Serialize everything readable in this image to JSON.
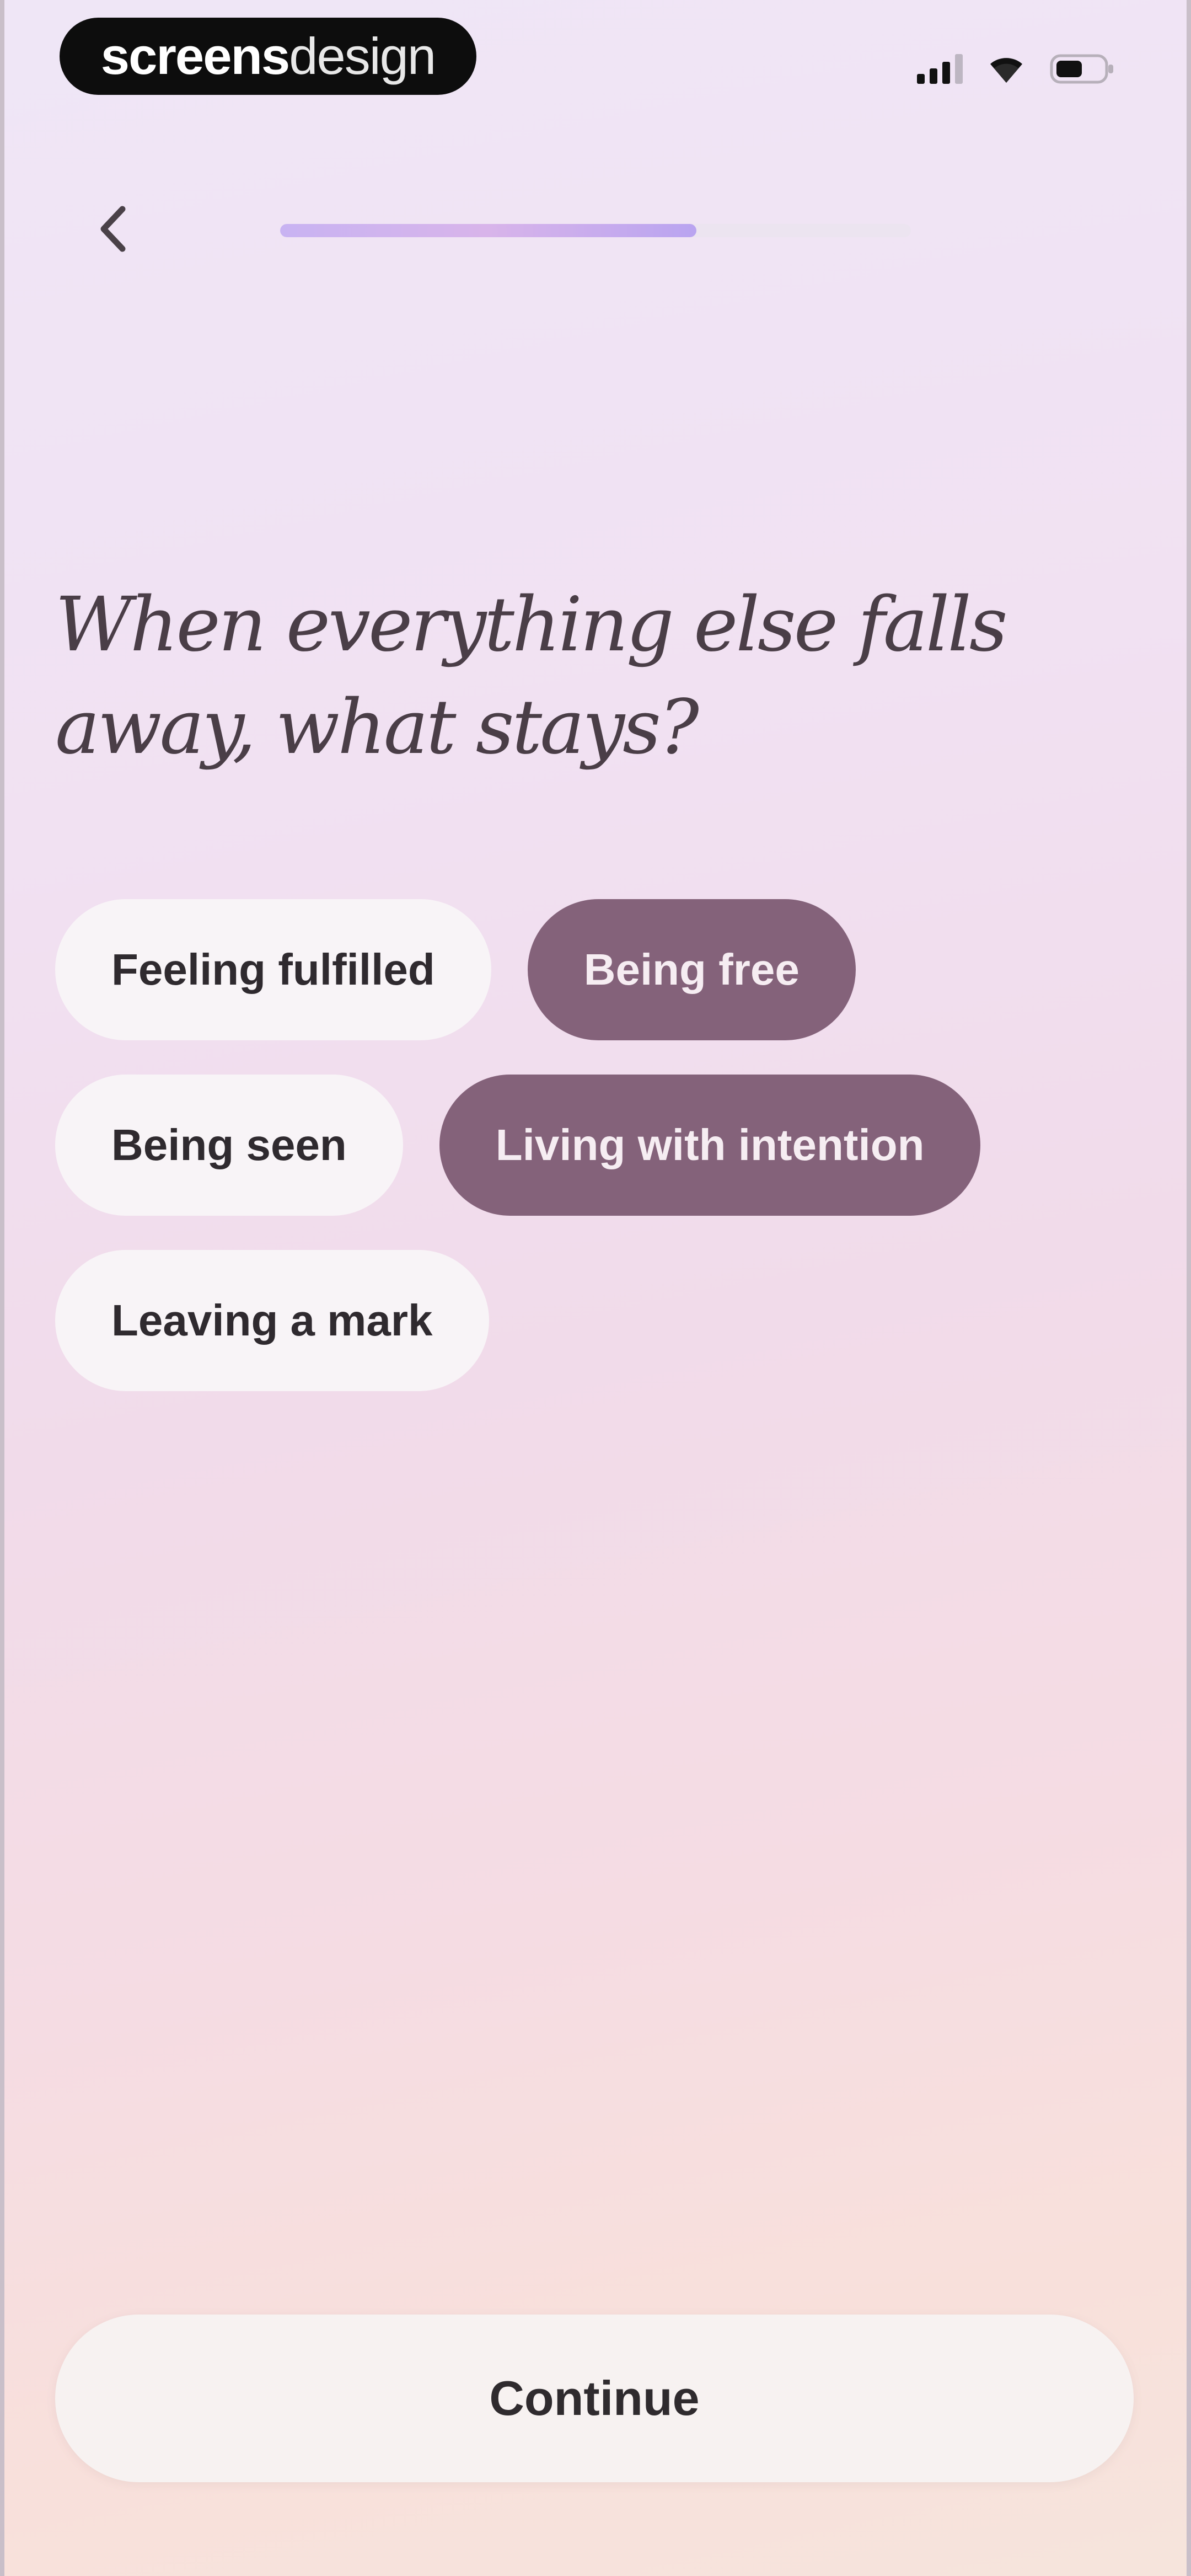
{
  "status_bar": {
    "brand_bold": "screens",
    "brand_light": "design",
    "icons": [
      "cellular-signal-icon",
      "wifi-icon",
      "battery-icon"
    ]
  },
  "nav": {
    "back_icon": "chevron-left-icon",
    "progress_fraction": 0.66
  },
  "question": {
    "title": "When everything else falls away, what stays?"
  },
  "options": [
    {
      "label": "Feeling fulfilled",
      "selected": false
    },
    {
      "label": "Being free",
      "selected": true
    },
    {
      "label": "Being seen",
      "selected": false
    },
    {
      "label": "Living with intention",
      "selected": true
    },
    {
      "label": "Leaving a mark",
      "selected": false
    }
  ],
  "footer": {
    "continue_label": "Continue"
  },
  "colors": {
    "chip_selected_bg": "#84627a",
    "chip_selected_text": "#f6edf2",
    "chip_unselected_bg": "#f8f4f7",
    "chip_unselected_text": "#2f2a2f",
    "title_text": "#4a3e47",
    "progress_fill": "#c8b3f2"
  }
}
